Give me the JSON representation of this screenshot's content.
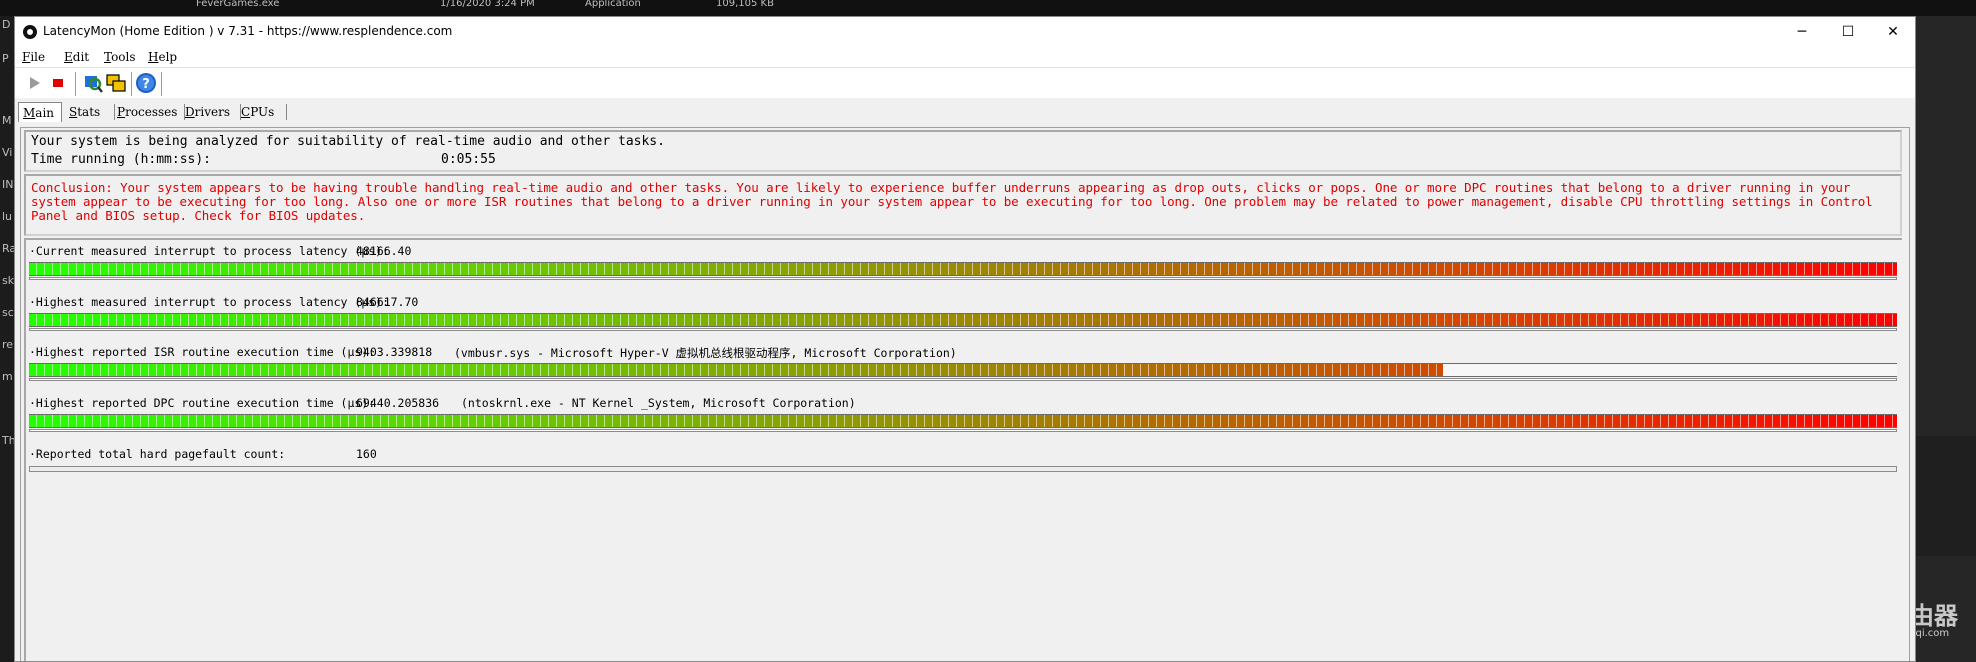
{
  "background": {
    "top_strip": [
      "FeverGames.exe",
      "1/16/2020 3:24 PM",
      "Application",
      "109,105 KB"
    ],
    "left_strip": [
      "D",
      "P",
      "M",
      "Vi",
      "IN",
      "lu",
      "Ra",
      "sk",
      "sc",
      "re",
      "m",
      "Th"
    ],
    "watermark": {
      "name": "路由器",
      "url": "luyouqi.com"
    }
  },
  "window": {
    "title": "LatencyMon  (Home Edition )  v 7.31 - https://www.resplendence.com",
    "controls": {
      "minimize": "─",
      "maximize": "☐",
      "close": "✕"
    }
  },
  "menu": [
    {
      "mnemonic": "F",
      "rest": "ile"
    },
    {
      "mnemonic": "E",
      "rest": "dit"
    },
    {
      "mnemonic": "T",
      "rest": "ools"
    },
    {
      "mnemonic": "H",
      "rest": "elp"
    }
  ],
  "toolbar": {
    "buttons": [
      "play-icon",
      "stop-icon",
      "analyze-icon",
      "windows-icon",
      "help-icon"
    ]
  },
  "tabs": [
    {
      "mnemonic": "M",
      "rest": "ain",
      "active": true
    },
    {
      "mnemonic": "S",
      "rest": "tats",
      "active": false
    },
    {
      "mnemonic": "P",
      "rest": "rocesses",
      "active": false
    },
    {
      "mnemonic": "D",
      "rest": "rivers",
      "active": false
    },
    {
      "mnemonic": "C",
      "rest": "PUs",
      "active": false
    }
  ],
  "status": {
    "analysis_text": "Your system is being analyzed for suitability of real-time audio and other tasks.",
    "time_label": "Time running (h:mm:ss):",
    "time_value": "0:05:55"
  },
  "conclusion": "Conclusion: Your system appears to be having trouble handling real-time audio and other tasks. You are likely to experience buffer underruns appearing as drop outs, clicks or pops. One or more DPC routines that belong to a driver running in your system appear to be executing for too long. Also one or more ISR routines that belong to a driver running in your system appear to be executing for too long. One problem may be related to power management, disable CPU throttling settings in Control Panel and BIOS setup. Check for BIOS updates.",
  "metrics": [
    {
      "label": "·Current measured interrupt to process latency (µs):",
      "value": "48166.40",
      "detail": "",
      "bar_fraction": 1.0
    },
    {
      "label": "·Highest measured interrupt to process latency (µs):",
      "value": "846617.70",
      "detail": "",
      "bar_fraction": 1.0
    },
    {
      "label": "·Highest reported ISR routine execution time (µs):",
      "value": "9403.339818",
      "detail": "(vmbusr.sys - Microsoft Hyper-V 虚拟机总线根驱动程序, Microsoft Corporation)",
      "bar_fraction": 0.757
    },
    {
      "label": "·Highest reported DPC routine execution time (µs):",
      "value": "69440.205836",
      "detail": "(ntoskrnl.exe - NT Kernel _System, Microsoft Corporation)",
      "bar_fraction": 1.0
    },
    {
      "label": "·Reported total hard pagefault count:",
      "value": "160",
      "detail": "",
      "bar_fraction": 0
    }
  ]
}
